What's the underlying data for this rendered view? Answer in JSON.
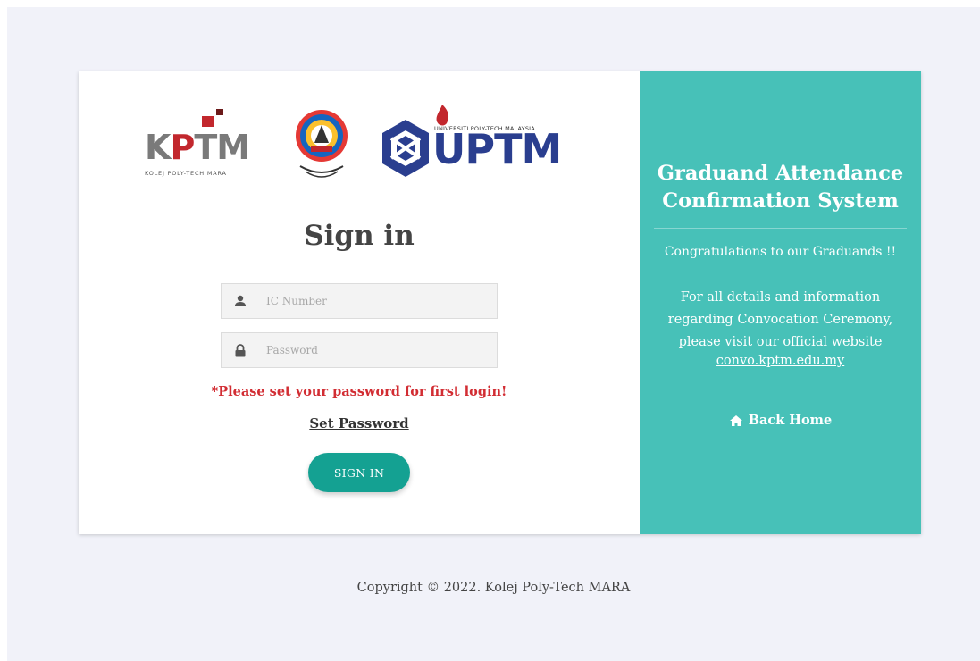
{
  "left": {
    "logos": {
      "kptm_letters": "KPTM",
      "kptm_subtitle": "KOLEJ POLY-TECH MARA",
      "uptm_text": "UPTM",
      "uptm_subtitle": "UNIVERSITI POLY-TECH MALAYSIA"
    },
    "title": "Sign in",
    "ic_field": {
      "placeholder": "IC Number",
      "value": ""
    },
    "password_field": {
      "placeholder": "Password",
      "value": ""
    },
    "warning": "*Please set your password for first login!",
    "set_password_link": "Set Password",
    "signin_button": "SIGN IN"
  },
  "right": {
    "title": "Graduand Attendance Confirmation System",
    "congrats": "Congratulations to our Graduands !!",
    "info": "For all details and information regarding Convocation Ceremony, please visit our official website",
    "website_link": "convo.kptm.edu.my",
    "back_home": "Back Home"
  },
  "footer": {
    "copyright": "Copyright © 2022. Kolej Poly-Tech MARA"
  },
  "colors": {
    "accent": "#47c1b8",
    "button": "#14a192",
    "warning": "#d22d33",
    "page_bg": "#f1f2f9"
  },
  "icons": {
    "ic_field": "user-icon",
    "password_field": "lock-icon",
    "back_home": "home-icon"
  }
}
